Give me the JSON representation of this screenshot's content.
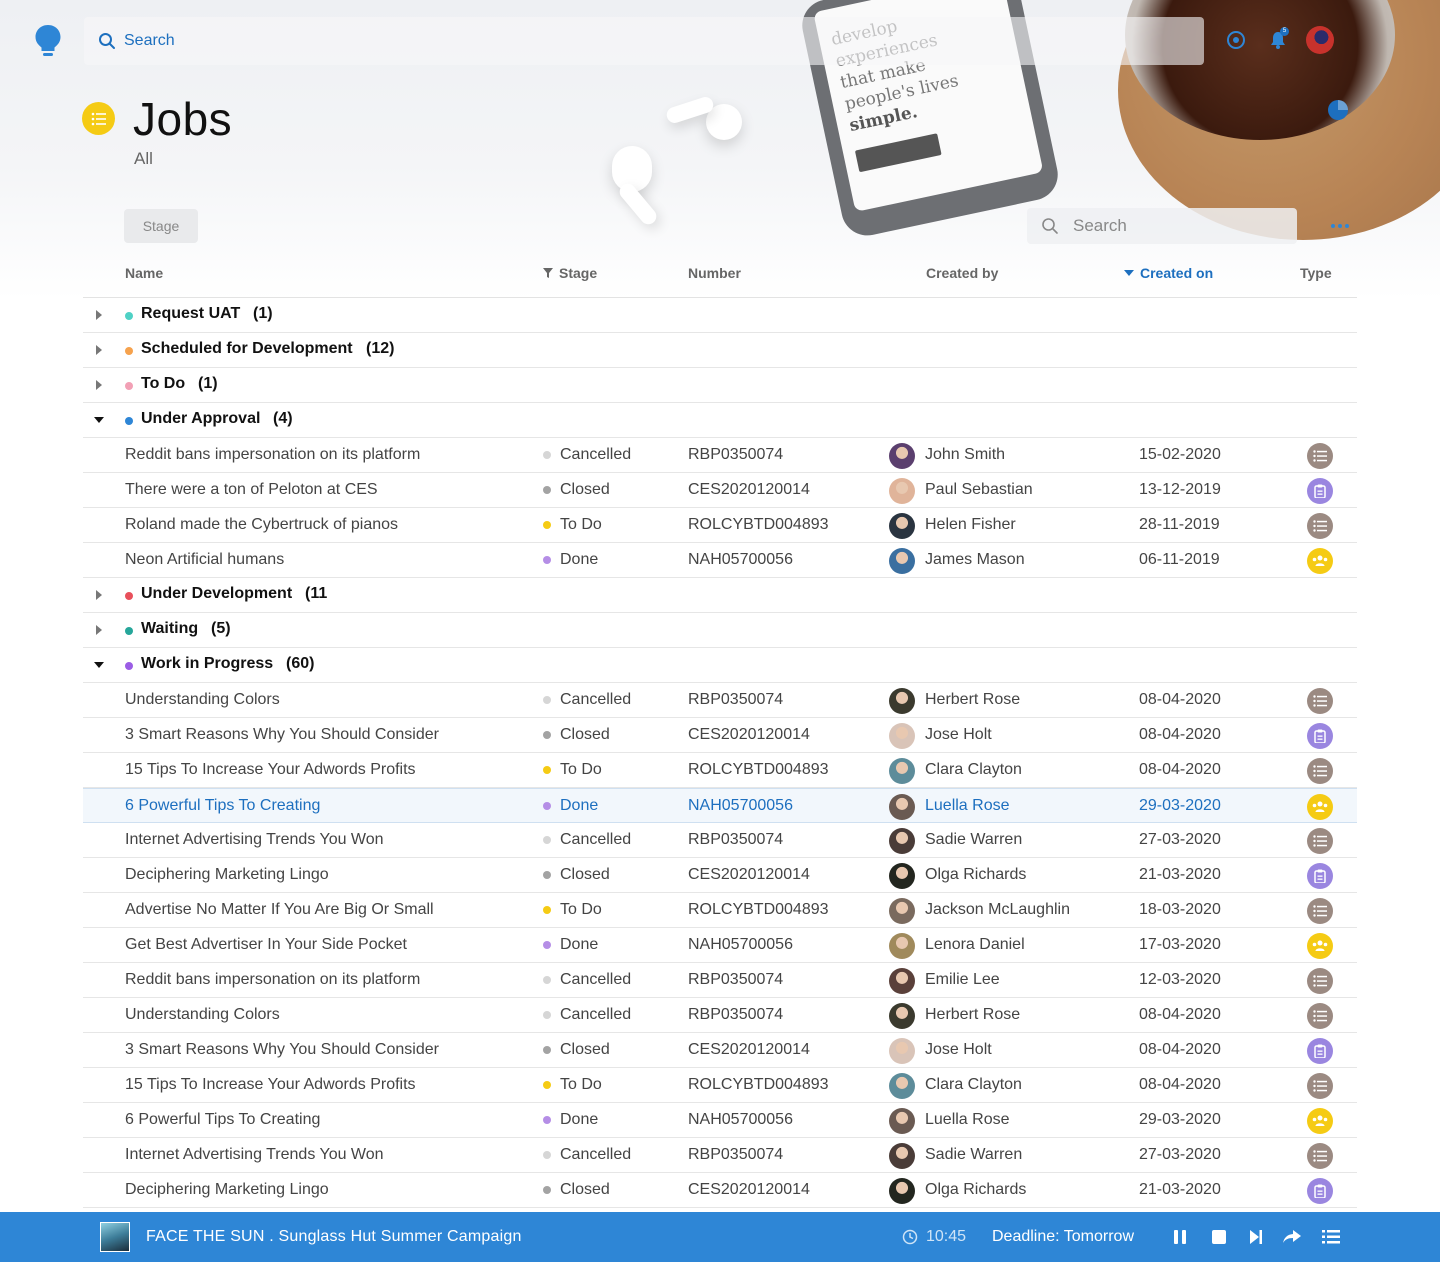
{
  "header": {
    "search_label": "Search",
    "notification_count": "5"
  },
  "page": {
    "title": "Jobs",
    "subtitle": "All",
    "stage_filter_label": "Stage",
    "table_search_placeholder": "Search"
  },
  "hero_image_text": {
    "lines": [
      "develop",
      "experiences",
      "that make",
      "people's lives",
      "simple."
    ]
  },
  "columns": {
    "name": "Name",
    "stage": "Stage",
    "number": "Number",
    "created_by": "Created by",
    "created_on": "Created on",
    "type": "Type"
  },
  "stage_colors": {
    "Cancelled": "#d6d6d6",
    "Closed": "#a3a3a3",
    "To Do": "#f5cb14",
    "Done": "#b58ee6"
  },
  "type_icons": {
    "checklist": {
      "icon": "checklist-icon",
      "color": "#9b8a82"
    },
    "clipboard": {
      "icon": "clipboard-icon",
      "color": "#9a86e0"
    },
    "team": {
      "icon": "team-icon",
      "color": "#f5cb14"
    }
  },
  "avatar_colors": {
    "John Smith": "#5b3f6e",
    "Paul Sebastian": "#e0b49a",
    "Helen Fisher": "#2a3440",
    "James Mason": "#3a6fa0",
    "Herbert Rose": "#3b3a2e",
    "Jose Holt": "#d9c4b8",
    "Clara Clayton": "#5d8c9a",
    "Luella Rose": "#6a5a52",
    "Sadie Warren": "#4a3c38",
    "Olga Richards": "#23261f",
    "Jackson McLaughlin": "#7a6a5e",
    "Lenora Daniel": "#a08a5c",
    "Emilie Lee": "#5a403a"
  },
  "rows": [
    {
      "kind": "group",
      "label": "Request UAT",
      "count": "(1)",
      "color": "#4fd1c5",
      "expanded": false
    },
    {
      "kind": "group",
      "label": "Scheduled for Development",
      "count": "(12)",
      "color": "#f6a24d",
      "expanded": false
    },
    {
      "kind": "group",
      "label": "To Do",
      "count": "(1)",
      "color": "#f2a0b5",
      "expanded": false
    },
    {
      "kind": "group",
      "label": "Under Approval",
      "count": "(4)",
      "color": "#2e86d6",
      "expanded": true
    },
    {
      "kind": "item",
      "name": "Reddit bans impersonation on its platform",
      "stage": "Cancelled",
      "number": "RBP0350074",
      "user": "John Smith",
      "date": "15-02-2020",
      "type": "checklist"
    },
    {
      "kind": "item",
      "name": "There were a ton of Peloton at CES",
      "stage": "Closed",
      "number": "CES2020120014",
      "user": "Paul Sebastian",
      "date": "13-12-2019",
      "type": "clipboard"
    },
    {
      "kind": "item",
      "name": "Roland made the Cybertruck of pianos",
      "stage": "To Do",
      "number": "ROLCYBTD004893",
      "user": "Helen Fisher",
      "date": "28-11-2019",
      "type": "checklist"
    },
    {
      "kind": "item",
      "name": "Neon Artificial humans",
      "stage": "Done",
      "number": "NAH05700056",
      "user": "James Mason",
      "date": "06-11-2019",
      "type": "team"
    },
    {
      "kind": "group",
      "label": "Under Development",
      "count": "(11",
      "color": "#e8505b",
      "expanded": false
    },
    {
      "kind": "group",
      "label": "Waiting",
      "count": "(5)",
      "color": "#26a69a",
      "expanded": false
    },
    {
      "kind": "group",
      "label": "Work in Progress",
      "count": "(60)",
      "color": "#9b5de5",
      "expanded": true
    },
    {
      "kind": "item",
      "name": "Understanding Colors",
      "stage": "Cancelled",
      "number": "RBP0350074",
      "user": "Herbert Rose",
      "date": "08-04-2020",
      "type": "checklist"
    },
    {
      "kind": "item",
      "name": "3 Smart Reasons Why You Should Consider",
      "stage": "Closed",
      "number": "CES2020120014",
      "user": "Jose Holt",
      "date": "08-04-2020",
      "type": "clipboard"
    },
    {
      "kind": "item",
      "name": "15 Tips To Increase Your Adwords Profits",
      "stage": "To Do",
      "number": "ROLCYBTD004893",
      "user": "Clara Clayton",
      "date": "08-04-2020",
      "type": "checklist"
    },
    {
      "kind": "item",
      "name": "6 Powerful Tips To Creating",
      "stage": "Done",
      "number": "NAH05700056",
      "user": "Luella Rose",
      "date": "29-03-2020",
      "type": "team",
      "selected": true
    },
    {
      "kind": "item",
      "name": "Internet Advertising Trends You Won",
      "stage": "Cancelled",
      "number": "RBP0350074",
      "user": "Sadie Warren",
      "date": "27-03-2020",
      "type": "checklist"
    },
    {
      "kind": "item",
      "name": "Deciphering Marketing Lingo",
      "stage": "Closed",
      "number": "CES2020120014",
      "user": "Olga Richards",
      "date": "21-03-2020",
      "type": "clipboard"
    },
    {
      "kind": "item",
      "name": "Advertise No Matter If You Are Big Or Small",
      "stage": "To Do",
      "number": "ROLCYBTD004893",
      "user": "Jackson McLaughlin",
      "date": "18-03-2020",
      "type": "checklist"
    },
    {
      "kind": "item",
      "name": "Get Best Advertiser In Your Side Pocket",
      "stage": "Done",
      "number": "NAH05700056",
      "user": "Lenora Daniel",
      "date": "17-03-2020",
      "type": "team"
    },
    {
      "kind": "item",
      "name": "Reddit bans impersonation on its platform",
      "stage": "Cancelled",
      "number": "RBP0350074",
      "user": "Emilie Lee",
      "date": "12-03-2020",
      "type": "checklist"
    },
    {
      "kind": "item",
      "name": "Understanding Colors",
      "stage": "Cancelled",
      "number": "RBP0350074",
      "user": "Herbert Rose",
      "date": "08-04-2020",
      "type": "checklist"
    },
    {
      "kind": "item",
      "name": "3 Smart Reasons Why You Should Consider",
      "stage": "Closed",
      "number": "CES2020120014",
      "user": "Jose Holt",
      "date": "08-04-2020",
      "type": "clipboard"
    },
    {
      "kind": "item",
      "name": "15 Tips To Increase Your Adwords Profits",
      "stage": "To Do",
      "number": "ROLCYBTD004893",
      "user": "Clara Clayton",
      "date": "08-04-2020",
      "type": "checklist"
    },
    {
      "kind": "item",
      "name": "6 Powerful Tips To Creating",
      "stage": "Done",
      "number": "NAH05700056",
      "user": "Luella Rose",
      "date": "29-03-2020",
      "type": "team"
    },
    {
      "kind": "item",
      "name": "Internet Advertising Trends You Won",
      "stage": "Cancelled",
      "number": "RBP0350074",
      "user": "Sadie Warren",
      "date": "27-03-2020",
      "type": "checklist"
    },
    {
      "kind": "item",
      "name": "Deciphering Marketing Lingo",
      "stage": "Closed",
      "number": "CES2020120014",
      "user": "Olga Richards",
      "date": "21-03-2020",
      "type": "clipboard"
    }
  ],
  "footer": {
    "title": "FACE THE SUN . Sunglass Hut Summer Campaign",
    "time": "10:45",
    "deadline": "Deadline: Tomorrow"
  }
}
